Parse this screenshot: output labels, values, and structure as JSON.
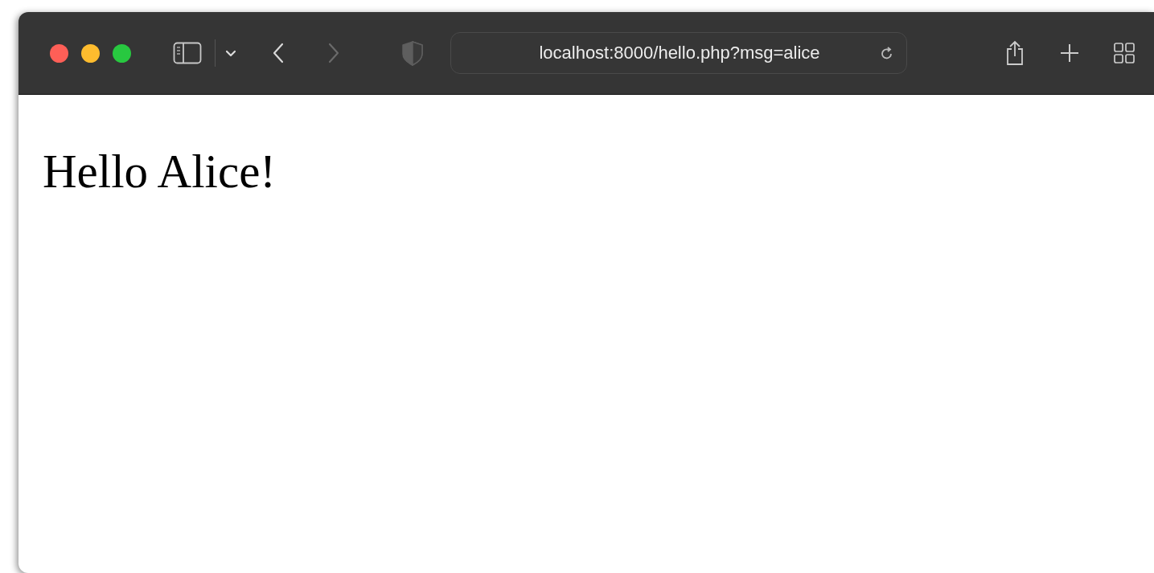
{
  "toolbar": {
    "navigation": [
      {
        "kind": "back",
        "disabled": false
      },
      {
        "kind": "forward",
        "disabled": true
      }
    ],
    "address": "localhost:8000/hello.php?msg=alice"
  },
  "page": {
    "heading": "Hello Alice!"
  }
}
